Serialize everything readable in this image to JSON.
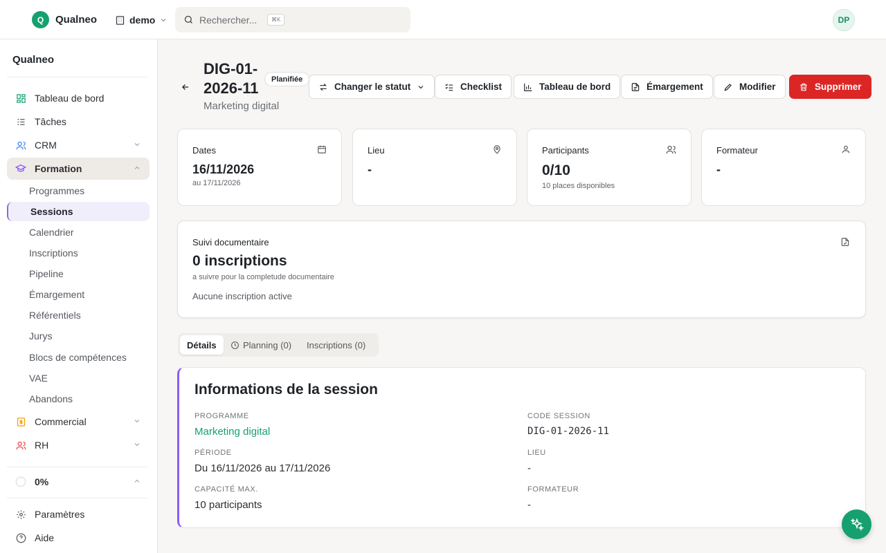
{
  "app": {
    "logo_letter": "Q",
    "brand": "Qualneo",
    "workspace": "demo",
    "user_initials": "DP"
  },
  "search": {
    "placeholder": "Rechercher...",
    "shortcut": "⌘K"
  },
  "sidebar": {
    "title": "Qualneo",
    "items": [
      {
        "label": "Tableau de bord",
        "icon": "dashboard-icon"
      },
      {
        "label": "Tâches",
        "icon": "tasks-icon"
      },
      {
        "label": "CRM",
        "icon": "users-icon"
      },
      {
        "label": "Formation",
        "icon": "graduation-cap-icon"
      }
    ],
    "formation_sub": [
      "Programmes",
      "Sessions",
      "Calendrier",
      "Inscriptions",
      "Pipeline",
      "Émargement",
      "Référentiels",
      "Jurys",
      "Blocs de compétences",
      "VAE",
      "Abandons"
    ],
    "commercial": "Commercial",
    "rh": "RH",
    "progress_label": "0%",
    "progress_value": 0,
    "settings": "Paramètres",
    "help": "Aide"
  },
  "header": {
    "code": "DIG-01-2026-11",
    "subtitle": "Marketing digital",
    "status_badge": "Planifiée"
  },
  "actions": {
    "change_status": "Changer le statut",
    "checklist": "Checklist",
    "dashboard": "Tableau de bord",
    "attendance": "Émargement",
    "edit": "Modifier",
    "delete": "Supprimer"
  },
  "stats": {
    "dates": {
      "label": "Dates",
      "value": "16/11/2026",
      "note": "au 17/11/2026"
    },
    "lieu": {
      "label": "Lieu",
      "value": "-"
    },
    "participants": {
      "label": "Participants",
      "value": "0/10",
      "note": "10 places disponibles"
    },
    "formateur": {
      "label": "Formateur",
      "value": "-"
    }
  },
  "docs": {
    "label": "Suivi documentaire",
    "value": "0 inscriptions",
    "note": "a suivre pour la completude documentaire",
    "empty": "Aucune inscription active"
  },
  "tabs": {
    "details": "Détails",
    "planning": "Planning (0)",
    "inscriptions": "Inscriptions (0)"
  },
  "info": {
    "title": "Informations de la session",
    "programme_label": "PROGRAMME",
    "programme_value": "Marketing digital",
    "code_label": "CODE SESSION",
    "code_value": "DIG-01-2026-11",
    "periode_label": "PÉRIODE",
    "periode_value": "Du 16/11/2026 au 17/11/2026",
    "lieu_label": "LIEU",
    "lieu_value": "-",
    "capacite_label": "CAPACITÉ MAX.",
    "capacite_value": "10 participants",
    "formateur_label": "FORMATEUR",
    "formateur_value": "-"
  },
  "colors": {
    "brand": "#16a06f",
    "danger": "#dc2626",
    "accent": "#8b5cf6"
  }
}
